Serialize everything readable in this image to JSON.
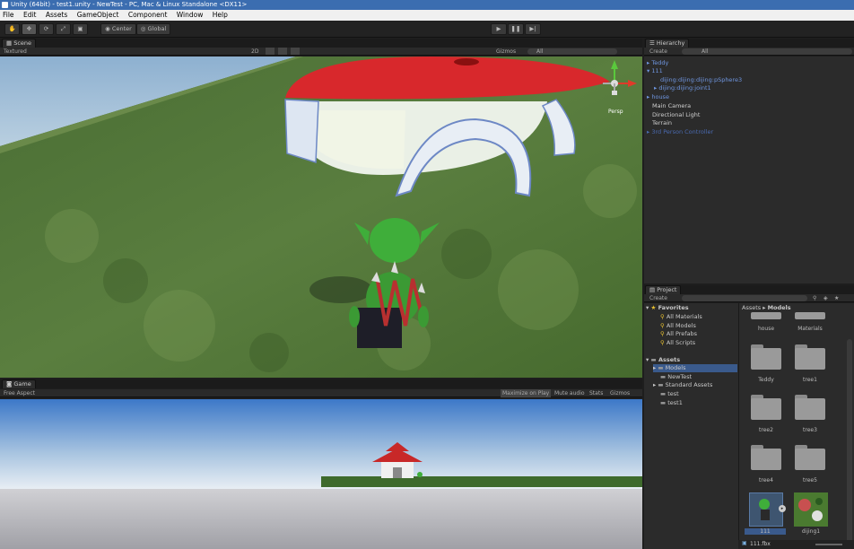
{
  "titlebar": {
    "title": "Unity (64bit) - test1.unity - NewTest - PC, Mac & Linux Standalone <DX11>"
  },
  "menu": [
    "File",
    "Edit",
    "Assets",
    "GameObject",
    "Component",
    "Window",
    "Help"
  ],
  "toolbar": {
    "center_label": "Center",
    "global_label": "Global"
  },
  "scene": {
    "tab_label": "Scene",
    "shading_mode": "Textured",
    "mode_2d": "2D",
    "gizmos_label": "Gizmos",
    "search_placeholder": "All",
    "persp_label": "Persp"
  },
  "game": {
    "tab_label": "Game",
    "aspect_label": "Free Aspect",
    "maximize_label": "Maximize on Play",
    "mute_label": "Mute audio",
    "stats_label": "Stats",
    "gizmos_label": "Gizmos"
  },
  "hierarchy": {
    "tab_label": "Hierarchy",
    "create_label": "Create",
    "search_placeholder": "All",
    "items": [
      {
        "label": "Teddy",
        "color": "#6f96e0"
      },
      {
        "label": "111",
        "color": "#6f96e0"
      },
      {
        "label": "dijing:dijing:dijing:pSphere3",
        "color": "#6f96e0"
      },
      {
        "label": "dijing:dijing:joint1",
        "color": "#6f96e0"
      },
      {
        "label": "house",
        "color": "#6f96e0"
      },
      {
        "label": "Main Camera",
        "color": "#d0d0d0"
      },
      {
        "label": "Directional Light",
        "color": "#d0d0d0"
      },
      {
        "label": "Terrain",
        "color": "#d0d0d0"
      },
      {
        "label": "3rd Person Controller",
        "color": "#4a6ab0"
      }
    ]
  },
  "project": {
    "tab_label": "Project",
    "create_label": "Create",
    "favorites_label": "Favorites",
    "favorites": [
      "All Materials",
      "All Models",
      "All Prefabs",
      "All Scripts"
    ],
    "assets_label": "Assets",
    "asset_folders": [
      "Models",
      "NewTest",
      "Standard Assets",
      "test",
      "test1"
    ],
    "breadcrumb": [
      "Assets",
      "Models"
    ],
    "grid_items": [
      "house",
      "Materials",
      "Teddy",
      "tree1",
      "tree2",
      "tree3",
      "tree4",
      "tree5",
      "111",
      "dijing1"
    ],
    "selected_file": "111.fbx"
  },
  "colors": {
    "accent_blue": "#3b6db0",
    "prefab_blue": "#6f96e0"
  }
}
